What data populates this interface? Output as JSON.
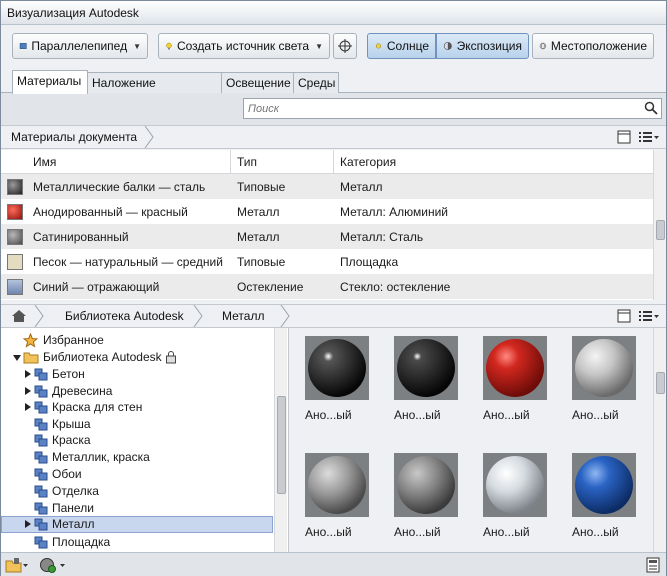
{
  "window": {
    "title": "Визуализация Autodesk"
  },
  "toolbar": {
    "environment_label": "Параллелепипед",
    "create_light_label": "Создать источник света",
    "sun_label": "Солнце",
    "exposure_label": "Экспозиция",
    "location_label": "Местоположение"
  },
  "tabs": [
    "Материалы",
    "Наложение материала",
    "Освещение",
    "Среды"
  ],
  "search": {
    "placeholder": "Поиск"
  },
  "doc_breadcrumb": "Материалы документа",
  "doc_table": {
    "columns": [
      "Имя",
      "Тип",
      "Категория"
    ],
    "rows": [
      {
        "name": "Металлические балки — сталь",
        "type": "Типовые",
        "category": "Металл",
        "swatch": "#3a3a3a"
      },
      {
        "name": "Анодированный — красный",
        "type": "Металл",
        "category": "Металл: Алюминий",
        "swatch": "#c0201c"
      },
      {
        "name": "Сатинированный",
        "type": "Металл",
        "category": "Металл: Сталь",
        "swatch": "#6e6e6e"
      },
      {
        "name": "Песок — натуральный — средний",
        "type": "Типовые",
        "category": "Площадка",
        "swatch": "#e4dcc0"
      },
      {
        "name": "Синий — отражающий",
        "type": "Остекление",
        "category": "Стекло: остекление",
        "swatch": "#8fa3c8"
      }
    ]
  },
  "lib_breadcrumb": {
    "root": "Библиотека Autodesk",
    "current": "Металл"
  },
  "tree": {
    "favorites": "Избранное",
    "library": "Библиотека Autodesk",
    "items": [
      "Бетон",
      "Древесина",
      "Краска для стен",
      "Крыша",
      "Краска",
      "Металлик, краска",
      "Обои",
      "Отделка",
      "Панели",
      "Металл",
      "Площадка"
    ]
  },
  "gallery": {
    "labels": [
      "Ано...ый",
      "Ано...ый",
      "Ано...ый",
      "Ано...ый",
      "Ано...ый",
      "Ано...ый",
      "Ано...ый",
      "Ано...ый"
    ],
    "colors": [
      "#202020",
      "#1a1a1a",
      "#c4211d",
      "#c8c8c8",
      "#9a9a9a",
      "#8a8a8a",
      "#d8dde2",
      "#1f59b8"
    ]
  }
}
